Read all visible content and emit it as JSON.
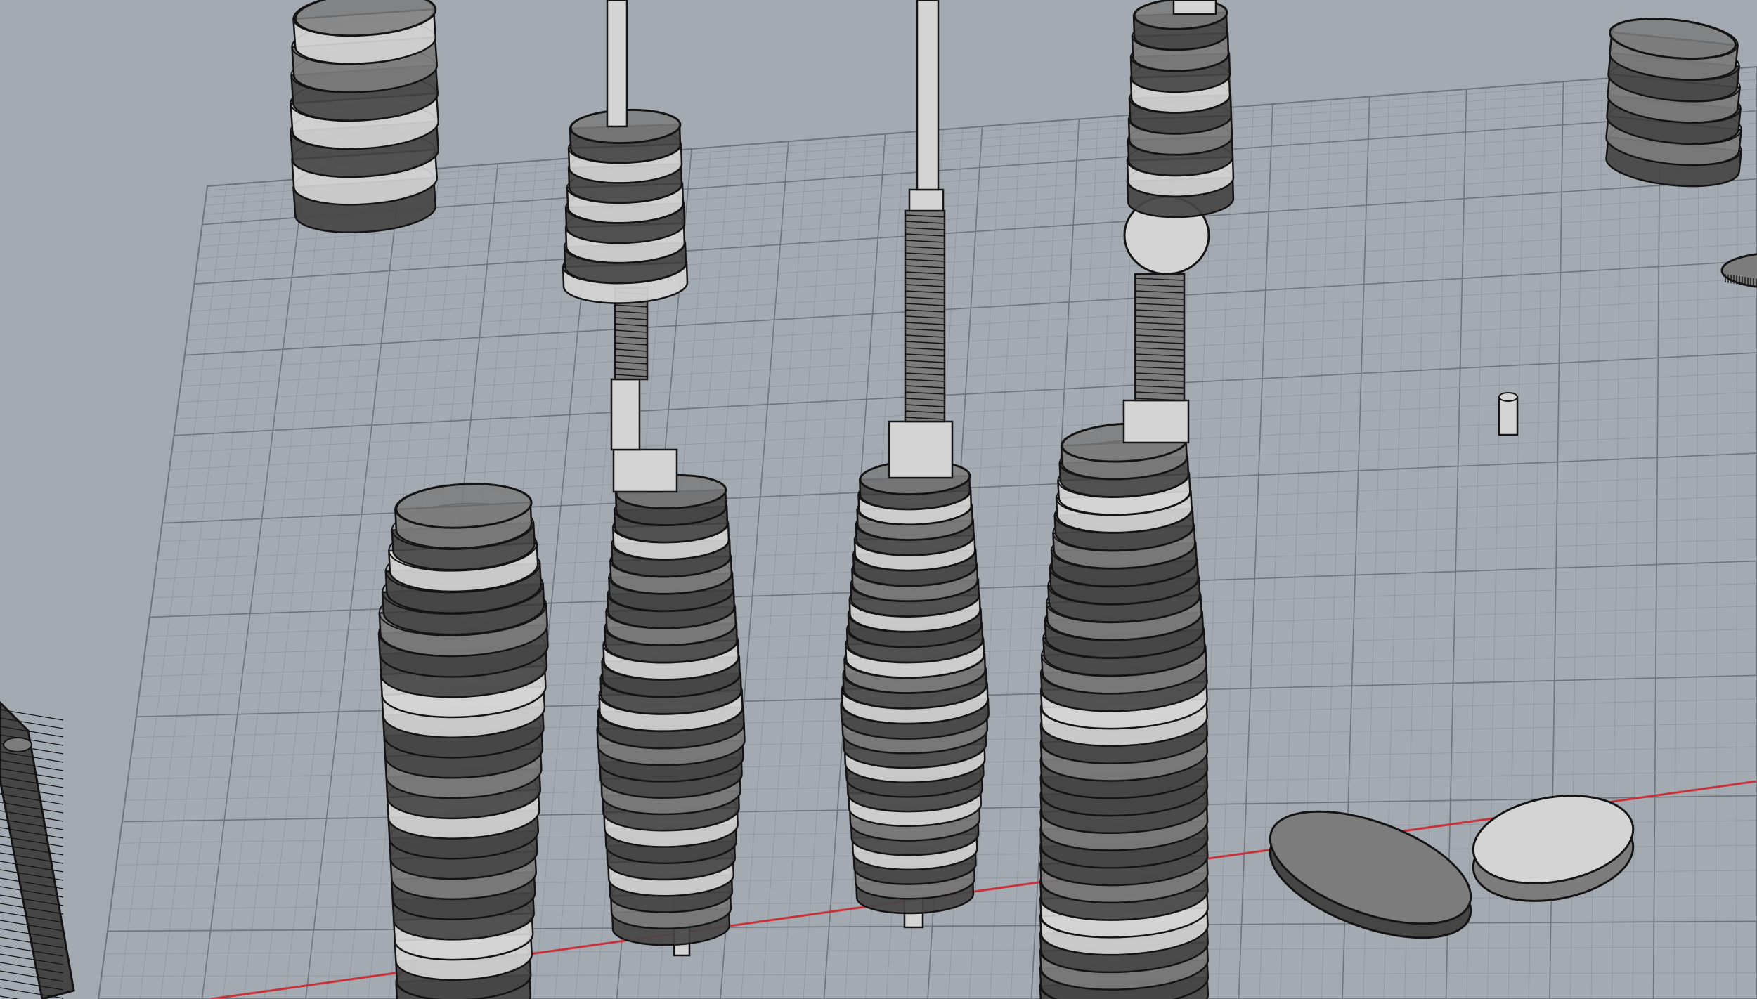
{
  "viewport": {
    "name": "perspective-viewport",
    "background_color": "#a3aab2",
    "grid_minor_color": "#8e959d",
    "grid_major_color": "#6d747c",
    "axis_x_color": "#c8323a",
    "shade_colors": {
      "light": "#d4d4d4",
      "mid": "#7c7c7c",
      "dark": "#454545",
      "outline": "#141414"
    }
  },
  "objects": [
    {
      "name": "tall-ribbed-stack-left",
      "kind": "ribbed-stack"
    },
    {
      "name": "threaded-rod-stack",
      "kind": "ribbed-stack-with-rod"
    },
    {
      "name": "center-rod-stack",
      "kind": "ribbed-stack-with-rod"
    },
    {
      "name": "large-right-stack",
      "kind": "ribbed-stack-with-rod"
    },
    {
      "name": "floating-ring-group-top-left",
      "kind": "ring-group"
    },
    {
      "name": "floating-ring-group-top-right",
      "kind": "ring-group"
    },
    {
      "name": "oval-disc-dark",
      "kind": "disc"
    },
    {
      "name": "oval-disc-light",
      "kind": "disc"
    },
    {
      "name": "small-pin",
      "kind": "cylinder"
    },
    {
      "name": "gear-edge-fragment",
      "kind": "gear"
    },
    {
      "name": "threaded-spindle-edge",
      "kind": "spindle"
    }
  ]
}
